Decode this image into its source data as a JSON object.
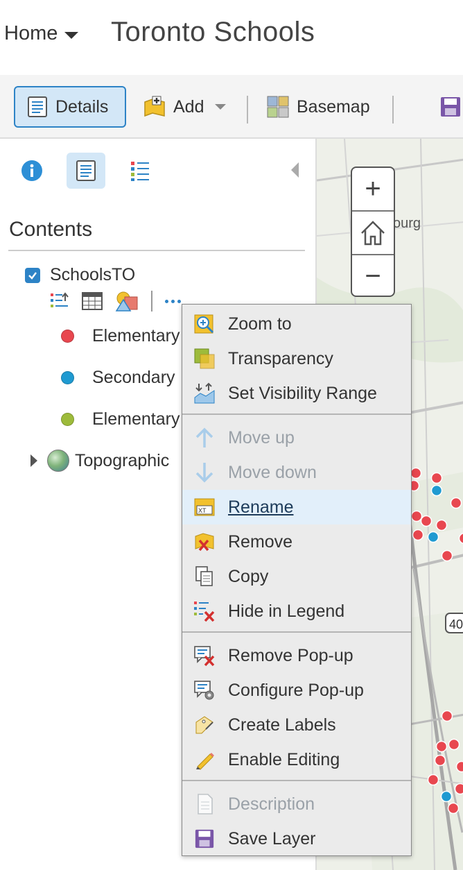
{
  "header": {
    "home_label": "Home",
    "title": "Toronto Schools"
  },
  "toolbar": {
    "details": "Details",
    "add": "Add",
    "basemap": "Basemap"
  },
  "panel": {
    "contents_title": "Contents",
    "layer": {
      "name": "SchoolsTO",
      "checked": true,
      "legend": [
        {
          "label": "Elementary",
          "color": "#e8474f"
        },
        {
          "label": "Secondary",
          "color": "#1f9ad1"
        },
        {
          "label": "Elementary",
          "color": "#9dbb3b"
        }
      ]
    },
    "basemap_layer": "Topographic"
  },
  "map": {
    "place_label": "ourg",
    "highway_label": "40",
    "zoom_in": "+",
    "zoom_out": "−"
  },
  "context_menu": {
    "group1": [
      "Zoom to",
      "Transparency",
      "Set Visibility Range"
    ],
    "group2": [
      "Move up",
      "Move down",
      "Rename",
      "Remove",
      "Copy",
      "Hide in Legend"
    ],
    "group3": [
      "Remove Pop-up",
      "Configure Pop-up",
      "Create Labels",
      "Enable Editing"
    ],
    "group4": [
      "Description",
      "Save Layer"
    ]
  },
  "colors": {
    "accent": "#2d83c6",
    "hover": "#e2effa"
  }
}
